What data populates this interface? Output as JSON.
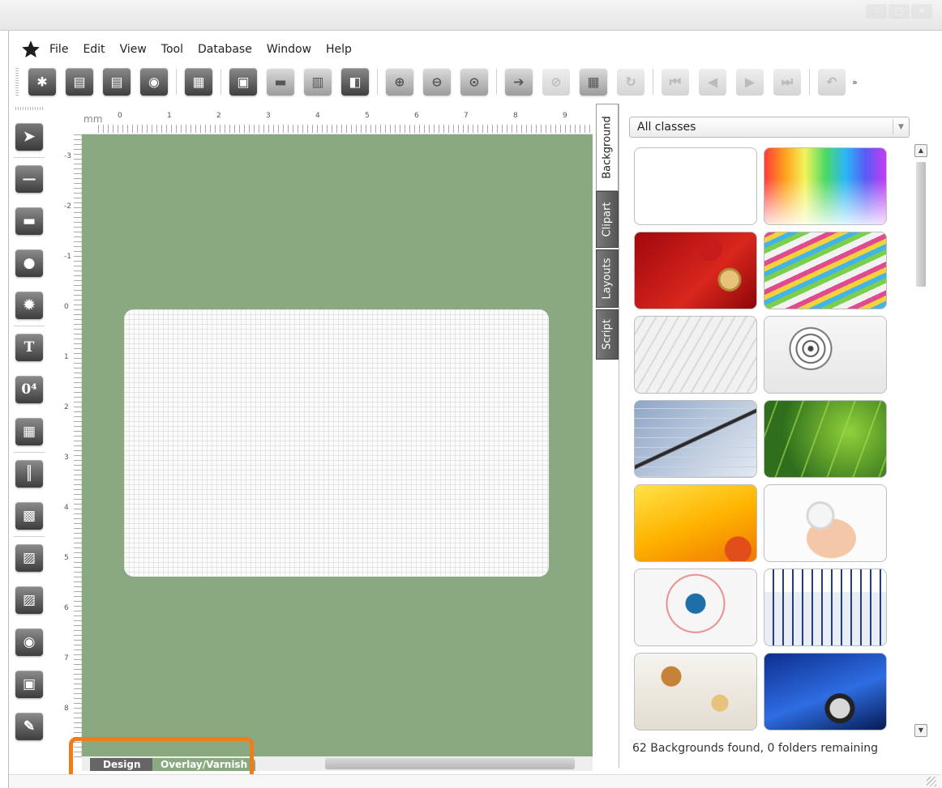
{
  "menu": [
    "File",
    "Edit",
    "View",
    "Tool",
    "Database",
    "Window",
    "Help"
  ],
  "toolbar": {
    "overflow": "»"
  },
  "ruler": {
    "unit": "mm",
    "h_labels": [
      "0",
      "1",
      "2",
      "3",
      "4",
      "5",
      "6",
      "7",
      "8",
      "9"
    ],
    "v_labels": [
      "-3",
      "-2",
      "-1",
      "0",
      "1",
      "2",
      "3",
      "4",
      "5",
      "6",
      "7",
      "8"
    ]
  },
  "left_tools": {
    "text_tool": "T"
  },
  "side_tabs": [
    "Background",
    "Clipart",
    "Layouts",
    "Script"
  ],
  "panel": {
    "filter": "All classes",
    "status": "62 Backgrounds found, 0 folders remaining",
    "thumbnail_subjects": [
      "blank",
      "rainbow gradient",
      "red christmas ornaments",
      "colorful ribbons",
      "blueprints",
      "target love",
      "pen on chart",
      "green grass",
      "orange waves",
      "hands holding ball",
      "network globe",
      "blue calendar",
      "autumn leaves",
      "blue car"
    ]
  },
  "bottom_tabs": {
    "design": "Design",
    "overlay": "Overlay/Varnish"
  },
  "colors": {
    "canvas": "#8aa980",
    "highlight": "#f07c1b",
    "toolbar_dark": "#4a4a4a"
  }
}
